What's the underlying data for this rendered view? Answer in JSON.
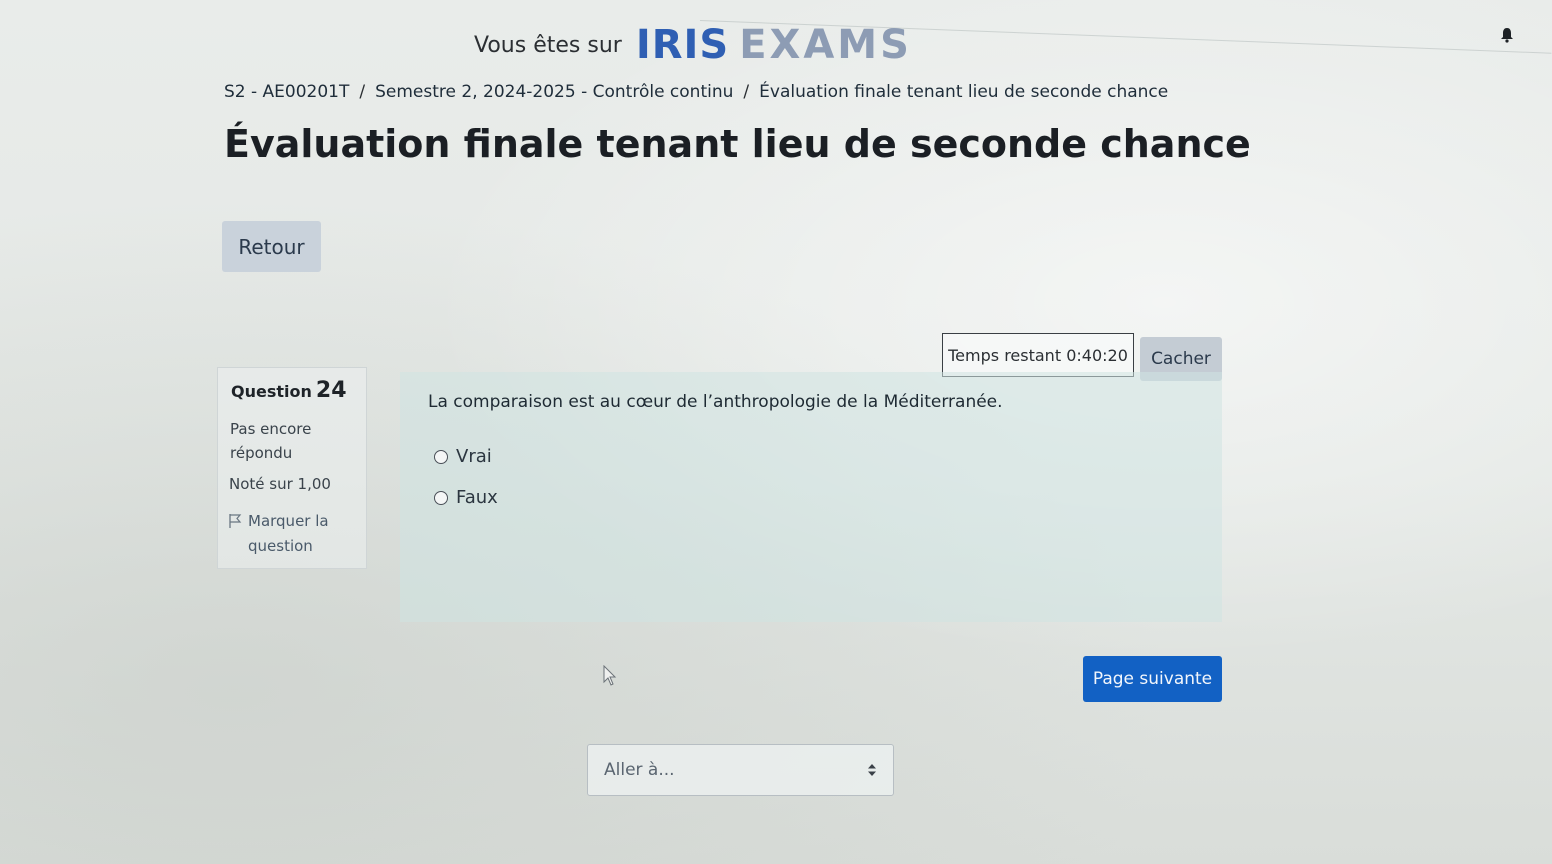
{
  "header": {
    "prefix": "Vous êtes sur",
    "logo_part1": "IRIS",
    "logo_part2": "EXAMS"
  },
  "breadcrumb": {
    "items": [
      "S2 - AE00201T",
      "Semestre 2, 2024-2025 - Contrôle continu",
      "Évaluation finale tenant lieu de seconde chance"
    ],
    "separator": "/"
  },
  "page": {
    "title": "Évaluation finale tenant lieu de seconde chance",
    "back_label": "Retour"
  },
  "timer": {
    "label": "Temps restant",
    "value": "0:40:20",
    "hide_label": "Cacher"
  },
  "question": {
    "label": "Question",
    "number": "24",
    "state": "Pas encore répondu",
    "grade": "Noté sur 1,00",
    "flag_label": "Marquer la question",
    "text": "La comparaison est au cœur de l’anthropologie de la Méditerranée.",
    "options": [
      "Vrai",
      "Faux"
    ]
  },
  "navigation": {
    "next_label": "Page suivante",
    "jump_placeholder": "Aller à..."
  },
  "colors": {
    "primary": "#1261c4",
    "secondary_button": "#c9d2db",
    "question_bg": "#d0e4e2"
  }
}
